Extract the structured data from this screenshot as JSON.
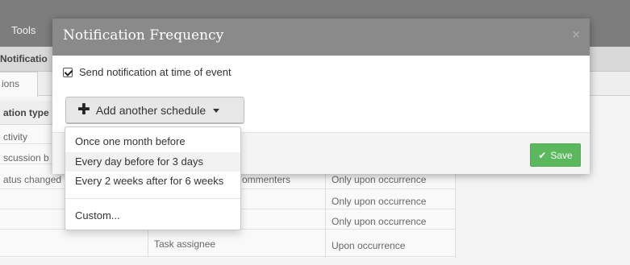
{
  "background": {
    "menu": "Tools",
    "subheader": "Notificatio",
    "tab": "ions",
    "table_header": "ation type",
    "rows": [
      {
        "col1": "ctivity",
        "col2": "",
        "col3": ""
      },
      {
        "col1": "scussion b",
        "col2": "",
        "col3": ""
      },
      {
        "col1": "atus changed",
        "col2": "ommenters",
        "col3": "Only upon occurrence"
      },
      {
        "col1": "",
        "col2": "",
        "col3": "Only upon occurrence"
      },
      {
        "col1": "",
        "col2": "",
        "col3": "Only upon occurrence"
      },
      {
        "col1": "",
        "col2": "Task assignee",
        "col3": "Upon occurrence"
      }
    ]
  },
  "modal": {
    "title": "Notification Frequency",
    "close_glyph": "×",
    "checkbox_label": "Send notification at time of event",
    "checkbox_checked": true,
    "add_button_label": "Add another schedule",
    "save_label": "Save"
  },
  "dropdown": {
    "items": [
      "Once one month before",
      "Every day before for 3 days",
      "Every 2 weeks after for 6 weeks",
      "Custom..."
    ],
    "highlighted_index": 1
  },
  "colors": {
    "header": "#8a8a8a",
    "save": "#5cb85c"
  }
}
